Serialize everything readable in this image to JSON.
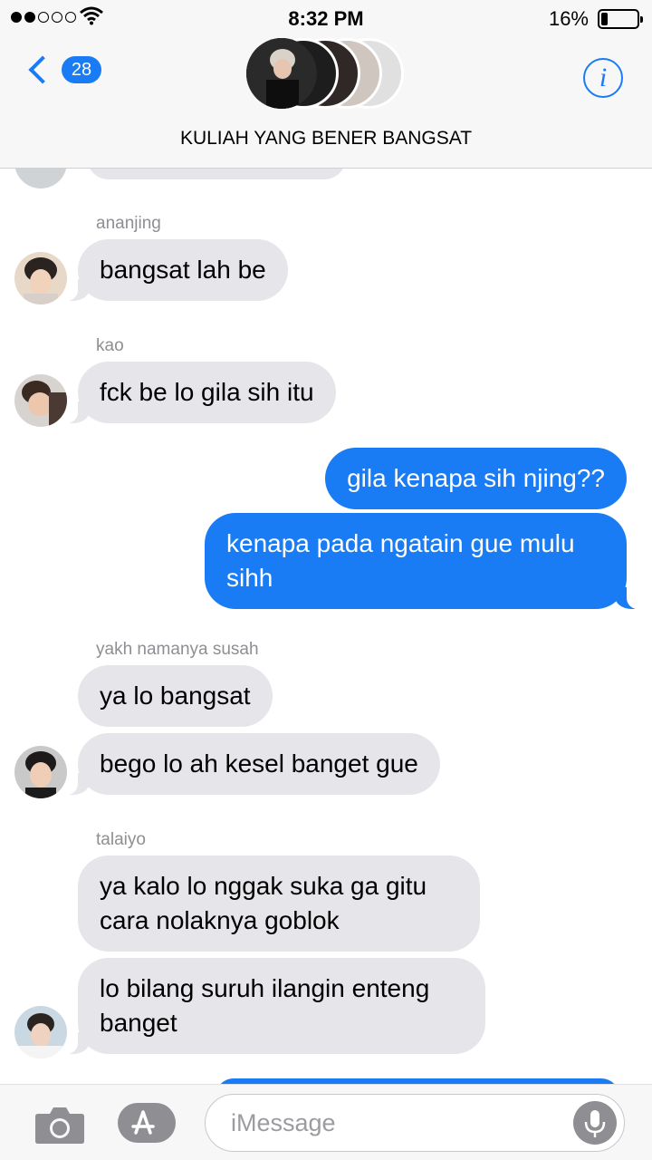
{
  "status_bar": {
    "time": "8:32 PM",
    "battery": "16%",
    "signal_bars_filled": 2,
    "signal_bars_total": 5
  },
  "header": {
    "back_badge": "28",
    "title": "KULIAH YANG BENER BANGSAT"
  },
  "messages": [
    {
      "sender": "ananjing",
      "text": "bangsat lah be",
      "side": "in"
    },
    {
      "sender": "kao",
      "text": "fck be lo gila sih itu",
      "side": "in"
    },
    {
      "text": "gila kenapa sih njing??",
      "side": "out"
    },
    {
      "text": "kenapa pada ngatain gue mulu sihh",
      "side": "out"
    },
    {
      "sender": "yakh namanya susah",
      "text": "ya lo bangsat",
      "side": "in"
    },
    {
      "text": "bego lo ah kesel banget gue",
      "side": "in"
    },
    {
      "sender": "talaiyo",
      "text": "ya kalo lo nggak suka ga gitu cara nolaknya goblok",
      "side": "in"
    },
    {
      "text": "lo bilang suruh ilangin enteng banget",
      "side": "in"
    }
  ],
  "input": {
    "placeholder": "iMessage"
  },
  "colors": {
    "accent": "#1a7cf4",
    "incoming_bubble": "#e5e5ea",
    "outgoing_bubble": "#1a7cf4"
  },
  "icons": [
    "wifi-icon",
    "battery-icon",
    "back-chevron-icon",
    "info-icon",
    "camera-icon",
    "app-store-icon",
    "microphone-icon"
  ]
}
